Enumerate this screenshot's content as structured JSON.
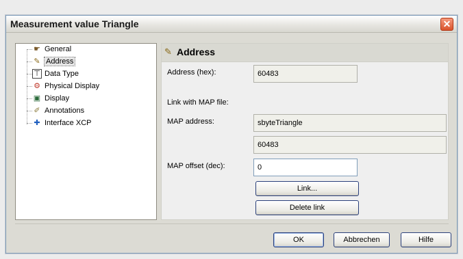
{
  "window": {
    "title": "Measurement value Triangle",
    "close_glyph": "✕"
  },
  "tree": {
    "items": [
      {
        "label": "General",
        "icon": "hand-pointer-icon",
        "glyph": "☛"
      },
      {
        "label": "Address",
        "icon": "address-pin-icon",
        "glyph": "✎",
        "selected": true
      },
      {
        "label": "Data Type",
        "icon": "datatype-icon",
        "glyph": "⊤"
      },
      {
        "label": "Physical Display",
        "icon": "physical-display-icon",
        "glyph": "⚙"
      },
      {
        "label": "Display",
        "icon": "monitor-icon",
        "glyph": "▣"
      },
      {
        "label": "Annotations",
        "icon": "annotations-icon",
        "glyph": "✐"
      },
      {
        "label": "Interface XCP",
        "icon": "puzzle-icon",
        "glyph": "✚"
      }
    ]
  },
  "panel": {
    "header": {
      "title": "Address",
      "glyph": "✎"
    },
    "address_hex_label": "Address (hex):",
    "address_hex_value": "60483",
    "link_map_label": "Link with MAP file:",
    "map_address_label": "MAP address:",
    "map_address_name": "sbyteTriangle",
    "map_address_value": "60483",
    "map_offset_label": "MAP offset (dec):",
    "map_offset_value": "0",
    "link_button": "Link...",
    "delete_link_button": "Delete link"
  },
  "footer": {
    "ok": "OK",
    "cancel": "Abbrechen",
    "help": "Hilfe"
  },
  "colors": {
    "title_close": "#d9532c",
    "field_border": "#7f9db9"
  }
}
